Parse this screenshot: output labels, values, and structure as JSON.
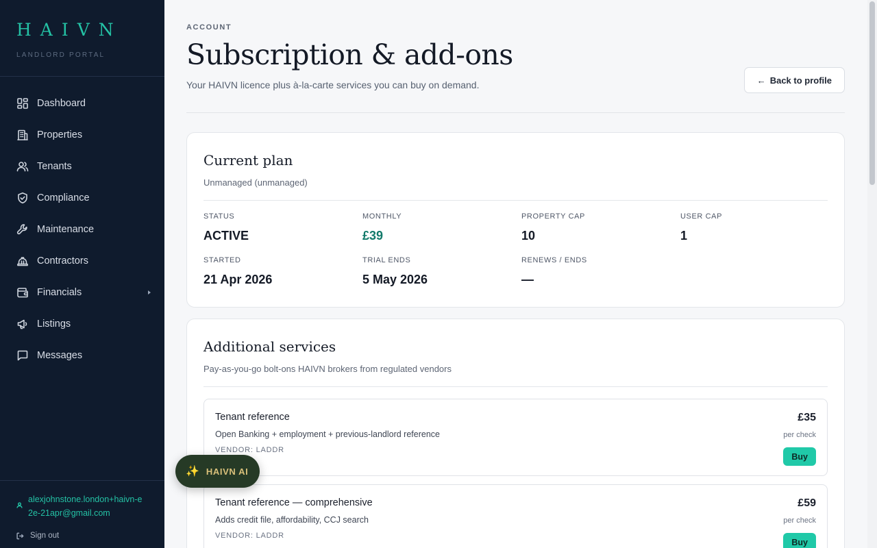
{
  "brand": {
    "logo": "HAIVN",
    "subtitle": "LANDLORD PORTAL"
  },
  "nav": {
    "items": [
      {
        "label": "Dashboard",
        "icon": "dashboard-icon"
      },
      {
        "label": "Properties",
        "icon": "building-icon"
      },
      {
        "label": "Tenants",
        "icon": "users-icon"
      },
      {
        "label": "Compliance",
        "icon": "shield-check-icon"
      },
      {
        "label": "Maintenance",
        "icon": "wrench-icon"
      },
      {
        "label": "Contractors",
        "icon": "hard-hat-icon"
      },
      {
        "label": "Financials",
        "icon": "wallet-icon"
      },
      {
        "label": "Listings",
        "icon": "megaphone-icon"
      },
      {
        "label": "Messages",
        "icon": "message-icon"
      }
    ]
  },
  "user": {
    "email": "alexjohnstone.london+haivn-e2e-21apr@gmail.com",
    "signout_label": "Sign out"
  },
  "header": {
    "eyebrow": "ACCOUNT",
    "title": "Subscription & add-ons",
    "subtitle": "Your HAIVN licence plus à-la-carte services you can buy on demand.",
    "back_label": "Back to profile"
  },
  "plan": {
    "title": "Current plan",
    "subtitle": "Unmanaged (unmanaged)",
    "stats": [
      {
        "label": "STATUS",
        "value": "ACTIVE"
      },
      {
        "label": "MONTHLY",
        "value": "£39"
      },
      {
        "label": "PROPERTY CAP",
        "value": "10"
      },
      {
        "label": "USER CAP",
        "value": "1"
      },
      {
        "label": "STARTED",
        "value": "21 Apr 2026"
      },
      {
        "label": "TRIAL ENDS",
        "value": "5 May 2026"
      },
      {
        "label": "RENEWS / ENDS",
        "value": "—"
      }
    ]
  },
  "services": {
    "title": "Additional services",
    "subtitle": "Pay-as-you-go bolt-ons HAIVN brokers from regulated vendors",
    "items": [
      {
        "name": "Tenant reference",
        "description": "Open Banking + employment + previous-landlord reference",
        "vendor": "VENDOR: LADDR",
        "price": "£35",
        "per": "per check",
        "buy_label": "Buy"
      },
      {
        "name": "Tenant reference — comprehensive",
        "description": "Adds credit file, affordability, CCJ search",
        "vendor": "VENDOR: LADDR",
        "price": "£59",
        "per": "per check",
        "buy_label": "Buy"
      }
    ]
  },
  "ai_button": {
    "label": "HAIVN AI"
  },
  "colors": {
    "sidebar_bg": "#0f1b2d",
    "accent": "#24c2a5",
    "buy_button": "#20c9a8",
    "monthly_value": "#127a6a"
  }
}
